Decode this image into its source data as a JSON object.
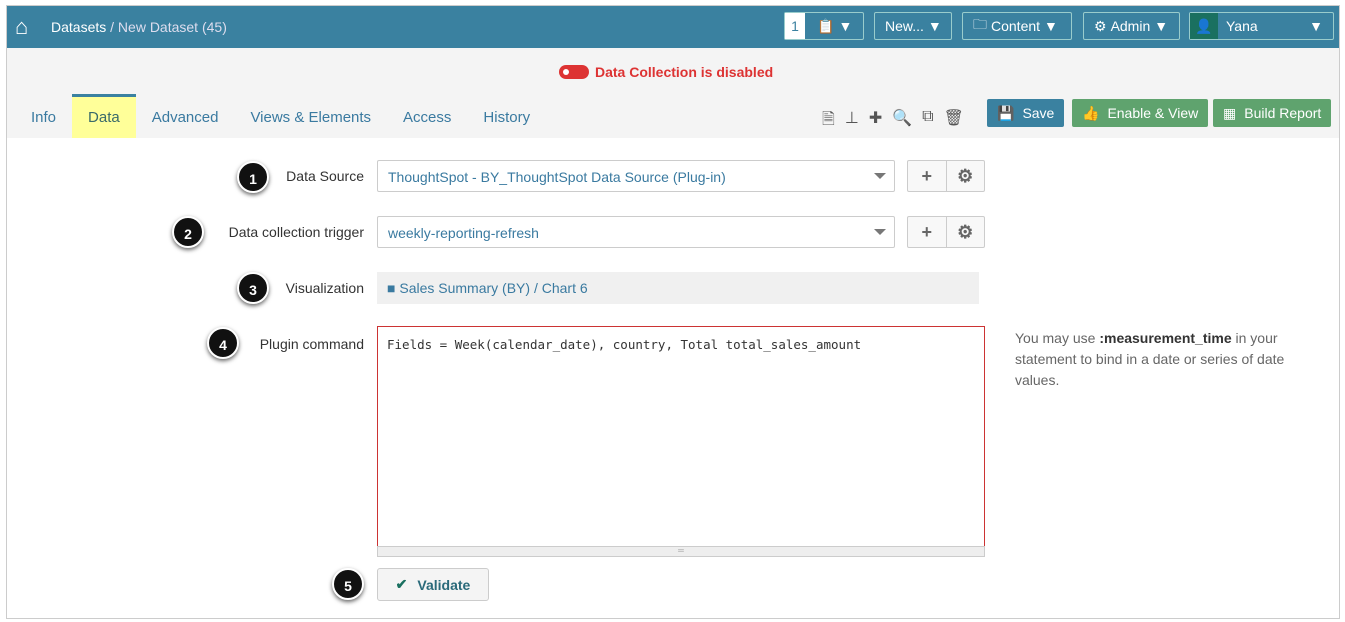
{
  "header": {
    "breadcrumb_root": "Datasets",
    "breadcrumb_sep": " / ",
    "breadcrumb_current": "New Dataset (45)",
    "count": "1",
    "new_label": "New...",
    "content_label": "Content",
    "admin_label": "Admin",
    "user": "Yana"
  },
  "status": "Data Collection is disabled",
  "tabs": [
    "Info",
    "Data",
    "Advanced",
    "Views & Elements",
    "Access",
    "History"
  ],
  "buttons": {
    "save": "Save",
    "enable": "Enable & View",
    "build": "Build Report",
    "validate": "Validate"
  },
  "form": {
    "data_source_label": "Data Source",
    "data_source": "ThoughtSpot - BY_ThoughtSpot Data Source (Plug-in)",
    "trigger_label": "Data collection trigger",
    "trigger": "weekly-reporting-refresh",
    "viz_label": "Visualization",
    "viz": "Sales Summary (BY) / Chart 6",
    "cmd_label": "Plugin command",
    "cmd": "Fields = Week(calendar_date), country, Total total_sales_amount",
    "hint_pre": "You may use ",
    "hint_bold": ":measurement_time",
    "hint_post": " in your statement to bind in a date or series of date values."
  },
  "steps": [
    "1",
    "2",
    "3",
    "4",
    "5"
  ]
}
